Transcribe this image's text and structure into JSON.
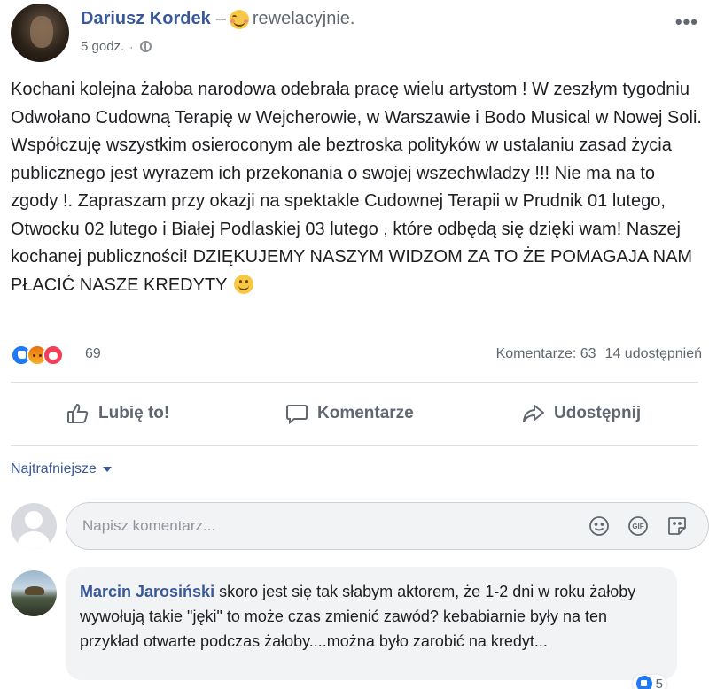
{
  "post": {
    "author": "Dariusz Kordek",
    "feeling_prefix": "–",
    "feeling": "rewelacyjnie.",
    "time": "5 godz.",
    "more_label": "•••",
    "text": "Kochani kolejna żałoba narodowa odebrała pracę wielu artystom ! W zeszłym tygodniu Odwołano Cudowną Terapię w Wejcherowie, w Warszawie i Bodo Musical w Nowej Soli. Współczuję wszystkim osieroconym ale beztroska polityków w ustalaniu zasad życia publicznego jest wyrazem ich przekonania o swojej wszechwladzy !!! Nie ma na to zgody !. Zapraszam przy okazji na spektakle Cudownej Terapii w Prudnik 01 lutego, Otwocku 02 lutego i Białej Podlaskiej 03 lutego , które odbędą się dzięki wam! Naszej kochanej publiczności! DZIĘKUJEMY NASZYM WIDZOM ZA TO ŻE POMAGAJA NAM PŁACIĆ NASZE KREDYTY"
  },
  "reactions": {
    "count": "69",
    "comments": "Komentarze: 63",
    "shares": "14 udostępnień",
    "types": [
      "like-icon",
      "angry-icon",
      "love-icon"
    ]
  },
  "actions": {
    "like": "Lubię to!",
    "comment": "Komentarze",
    "share": "Udostępnij"
  },
  "sort": {
    "label": "Najtrafniejsze"
  },
  "composer": {
    "placeholder": "Napisz komentarz..."
  },
  "comment": {
    "author": "Marcin Jarosiński",
    "text": "skoro jest się tak słabym aktorem, że 1-2 dni w roku żałoby wywołują takie \"jęki\" to może czas zmienić zawód? kebabiarnie były na ten przykład otwarte podczas żałoby....można było zarobić na kredyt...",
    "likes": "5"
  },
  "colors": {
    "link_blue": "#385898",
    "like_blue": "#2078f4",
    "love_red": "#f33e58",
    "secondary_text": "#606770"
  }
}
